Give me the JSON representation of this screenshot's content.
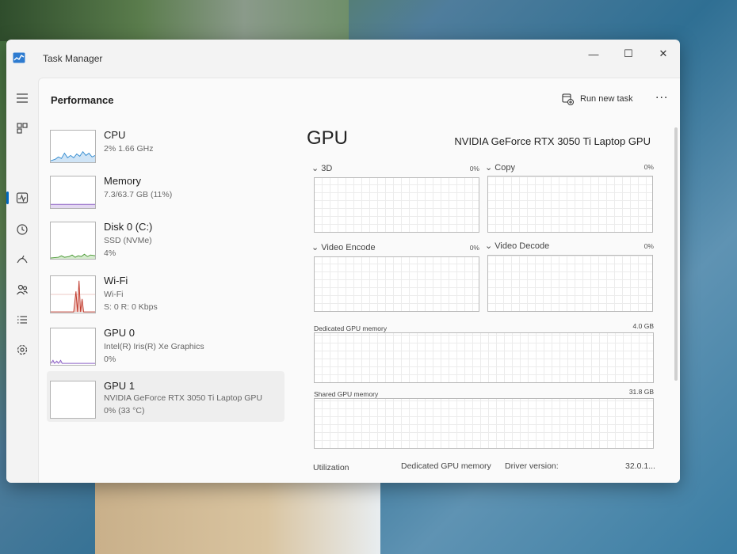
{
  "window": {
    "title": "Task Manager",
    "controls": {
      "minimize": "—",
      "maximize": "☐",
      "close": "✕"
    }
  },
  "header": {
    "page_title": "Performance",
    "run_task_label": "Run new task",
    "more_label": "..."
  },
  "devices": [
    {
      "name": "CPU",
      "line1": "2%  1.66 GHz",
      "line2": ""
    },
    {
      "name": "Memory",
      "line1": "7.3/63.7 GB (11%)",
      "line2": ""
    },
    {
      "name": "Disk 0 (C:)",
      "line1": "SSD (NVMe)",
      "line2": "4%"
    },
    {
      "name": "Wi-Fi",
      "line1": "Wi-Fi",
      "line2": "S: 0 R: 0 Kbps"
    },
    {
      "name": "GPU 0",
      "line1": "Intel(R) Iris(R) Xe Graphics",
      "line2": "0%"
    },
    {
      "name": "GPU 1",
      "line1": "NVIDIA GeForce RTX 3050 Ti Laptop GPU",
      "line2": "0% (33 °C)"
    }
  ],
  "detail": {
    "title": "GPU",
    "model": "NVIDIA GeForce RTX 3050 Ti Laptop GPU",
    "engines": [
      {
        "label": "3D",
        "percent": "0%"
      },
      {
        "label": "Copy",
        "percent": "0%"
      },
      {
        "label": "Video Encode",
        "percent": "0%"
      },
      {
        "label": "Video Decode",
        "percent": "0%"
      }
    ],
    "dedicated_label": "Dedicated GPU memory",
    "dedicated_max": "4.0 GB",
    "shared_label": "Shared GPU memory",
    "shared_max": "31.8 GB",
    "footer": {
      "utilization": "Utilization",
      "dedicated": "Dedicated GPU memory",
      "driver_label": "Driver version:",
      "driver_value": "32.0.1..."
    }
  },
  "colors": {
    "cpu": "#3a8fd1",
    "memory": "#8e63c6",
    "disk": "#4d9a38",
    "wifi": "#c0392b",
    "gpu": "#8e63c6",
    "accent": "#0067c0"
  },
  "icons": {
    "menu": "hamburger-icon",
    "processes": "processes-icon",
    "performance": "performance-icon",
    "history": "app-history-icon",
    "startup": "startup-apps-icon",
    "users": "users-icon",
    "details": "details-icon",
    "services": "services-icon",
    "settings": "gear-icon"
  }
}
